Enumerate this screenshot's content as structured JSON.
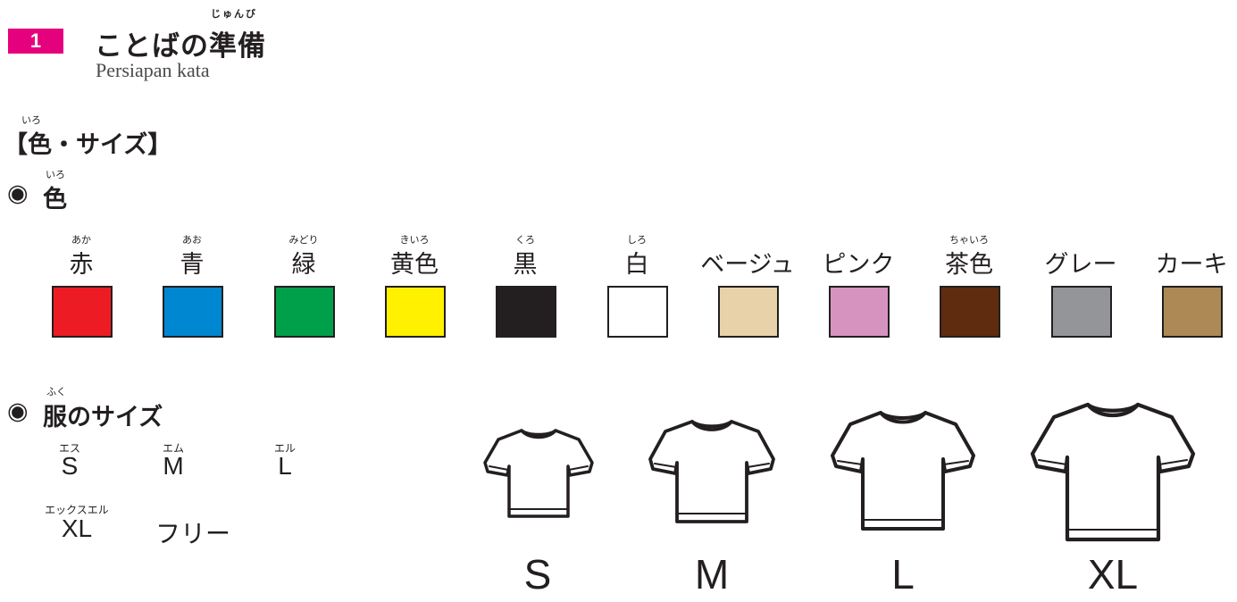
{
  "header": {
    "number": "1",
    "title": "ことばの準備",
    "title_ruby": "じゅんび",
    "subtitle": "Persiapan kata"
  },
  "section": {
    "heading": "【色・サイズ】",
    "heading_ruby": "いろ"
  },
  "colors_section": {
    "bullet": "◉",
    "heading": "色",
    "heading_ruby": "いろ",
    "items": [
      {
        "name": "赤",
        "ruby": "あか",
        "hex": "#ed1c24"
      },
      {
        "name": "青",
        "ruby": "あお",
        "hex": "#0087d1"
      },
      {
        "name": "緑",
        "ruby": "みどり",
        "hex": "#00a04a"
      },
      {
        "name": "黄色",
        "ruby": "きいろ",
        "hex": "#fff100"
      },
      {
        "name": "黒",
        "ruby": "くろ",
        "hex": "#231f20"
      },
      {
        "name": "白",
        "ruby": "しろ",
        "hex": "#ffffff"
      },
      {
        "name": "ベージュ",
        "ruby": "",
        "hex": "#e8d2aa"
      },
      {
        "name": "ピンク",
        "ruby": "",
        "hex": "#d693c0"
      },
      {
        "name": "茶色",
        "ruby": "ちゃいろ",
        "hex": "#5f2c10"
      },
      {
        "name": "グレー",
        "ruby": "",
        "hex": "#939598"
      },
      {
        "name": "カーキ",
        "ruby": "",
        "hex": "#ad8955"
      }
    ]
  },
  "sizes_section": {
    "bullet": "◉",
    "heading": "服のサイズ",
    "heading_ruby": "ふく",
    "items": [
      {
        "label": "S",
        "ruby": "エス"
      },
      {
        "label": "M",
        "ruby": "エム"
      },
      {
        "label": "L",
        "ruby": "エル"
      },
      {
        "label": "XL",
        "ruby": "エックスエル"
      },
      {
        "label": "フリー",
        "ruby": ""
      }
    ]
  },
  "shirts": [
    {
      "label": "S"
    },
    {
      "label": "M"
    },
    {
      "label": "L"
    },
    {
      "label": "XL"
    }
  ]
}
